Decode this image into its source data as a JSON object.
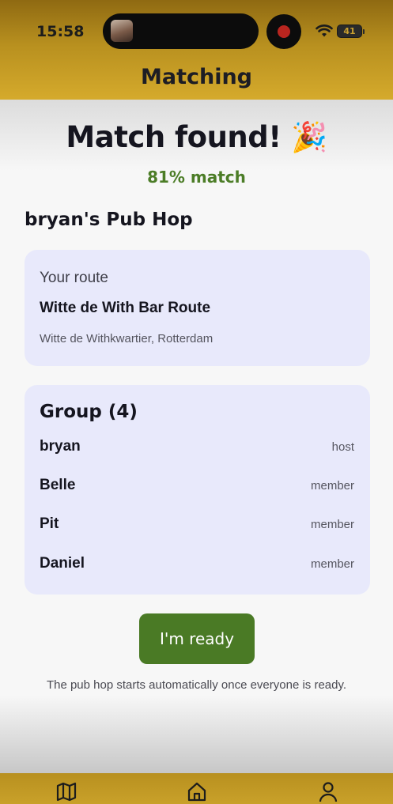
{
  "status_bar": {
    "time": "15:58",
    "battery": "41"
  },
  "header": {
    "title": "Matching"
  },
  "match": {
    "headline": "Match found! 🎉",
    "percentage": "81% match"
  },
  "hop": {
    "name": "bryan's Pub Hop"
  },
  "route_card": {
    "label": "Your route",
    "name": "Witte de With Bar Route",
    "area": "Witte de Withkwartier, Rotterdam"
  },
  "group": {
    "title": "Group (4)",
    "members": [
      {
        "name": "bryan",
        "role": "host"
      },
      {
        "name": "Belle",
        "role": "member"
      },
      {
        "name": "Pit",
        "role": "member"
      },
      {
        "name": "Daniel",
        "role": "member"
      }
    ]
  },
  "actions": {
    "ready_label": "I'm ready"
  },
  "hint": {
    "text": "The pub hop starts automatically once everyone is ready."
  },
  "tabbar": {
    "icons": [
      "map-icon",
      "home-icon",
      "profile-icon"
    ]
  },
  "colors": {
    "header": "#b8901f",
    "accent_green": "#4a7a25",
    "card_bg": "#e8e9fb"
  }
}
